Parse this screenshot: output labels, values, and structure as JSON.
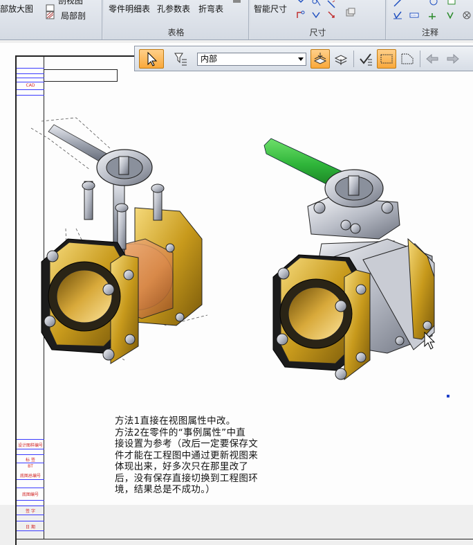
{
  "ribbon": {
    "view_group": {
      "items": [
        {
          "label": "部放大图",
          "icon": "detail-view-icon"
        },
        {
          "label": "剖视图",
          "icon": "section-view-icon"
        },
        {
          "label": "局部剖",
          "icon": "broken-out-section-icon"
        }
      ]
    },
    "table_group": {
      "label": "表格",
      "items": [
        {
          "label": "零件明细表",
          "icon": "parts-list-icon"
        },
        {
          "label": "孔参数表",
          "icon": "hole-table-icon"
        },
        {
          "label": "折弯表",
          "icon": "bend-table-icon"
        }
      ]
    },
    "dimension_group": {
      "label": "尺寸",
      "items": [
        {
          "label": "智能尺寸",
          "icon": "smart-dimension-icon"
        }
      ]
    },
    "annotation_group": {
      "label": "注释"
    }
  },
  "toolbar": {
    "select_value": "内部",
    "buttons": [
      {
        "name": "select-tool-button",
        "icon": "cursor-icon",
        "active": true
      },
      {
        "name": "filter-button",
        "icon": "filter-icon",
        "active": false
      },
      {
        "name": "layer-button",
        "icon": "layer-icon",
        "active": true
      },
      {
        "name": "layer-move-button",
        "icon": "layer-move-icon",
        "active": false
      },
      {
        "name": "check-button",
        "icon": "check-icon",
        "active": false
      },
      {
        "name": "rect-select-button",
        "icon": "rectangle-select-icon",
        "active": true
      },
      {
        "name": "lasso-select-button",
        "icon": "lasso-select-icon",
        "active": false
      },
      {
        "name": "back-button",
        "icon": "arrow-left-icon",
        "active": false
      },
      {
        "name": "forward-button",
        "icon": "arrow-right-icon",
        "active": false
      }
    ]
  },
  "titleblock": {
    "strip_labels": [
      "CAD",
      "设计图样编号",
      "标 签",
      "BT",
      "底图总编号",
      "底图编号",
      "签 字",
      "日 期"
    ]
  },
  "note": {
    "lines": [
      "方法1直接在视图属性中改。",
      "方法2在零件的“事例属性”中直",
      "接设置为参考（改后一定要保存文",
      "件才能在工程图中通过更新视图来",
      "体现出来，好多次只在那里改了",
      "后，没有保存直接切换到工程图环",
      "境，结果总是不成功。）"
    ]
  },
  "colors": {
    "flange_gold": "#c89a1c",
    "body_orange": "#d98a4a",
    "handle_green": "#2fb53a",
    "body_gray": "#b8bcc6",
    "active_button": "#f9a83a"
  }
}
